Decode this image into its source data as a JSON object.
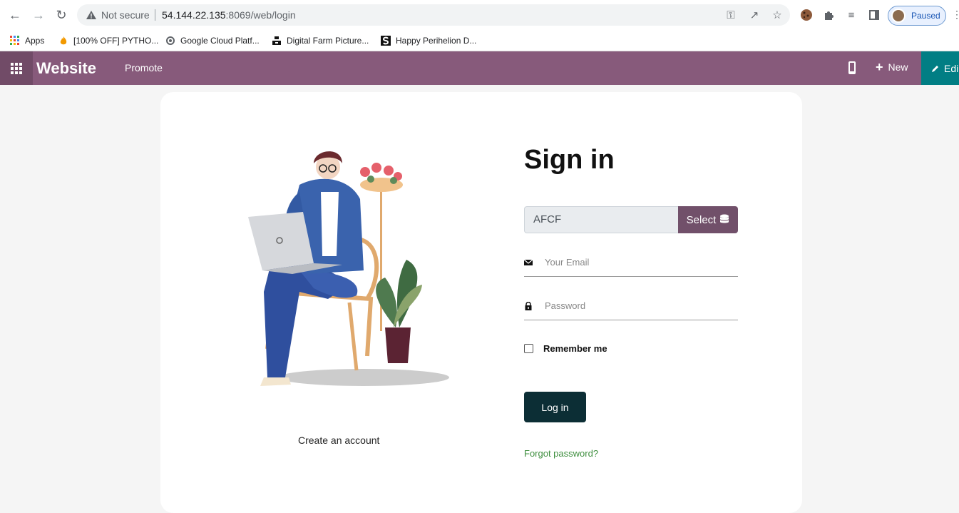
{
  "browser": {
    "security_label": "Not secure",
    "url_host": "54.144.22.135",
    "url_path": ":8069/web/login",
    "profile_label": "Paused",
    "bookmarks": [
      {
        "label": "Apps",
        "icon": "apps-grid-icon"
      },
      {
        "label": "[100% OFF] PYTHO...",
        "icon": "fire-icon"
      },
      {
        "label": "Google Cloud Platf...",
        "icon": "gcp-icon"
      },
      {
        "label": "Digital Farm Picture...",
        "icon": "unsplash-icon"
      },
      {
        "label": "Happy Perihelion D...",
        "icon": "s-logo-icon"
      }
    ]
  },
  "odoo_nav": {
    "brand": "Website",
    "menu_promote": "Promote",
    "new_label": "New",
    "edit_label": "Edi"
  },
  "login": {
    "title": "Sign in",
    "database_value": "AFCF",
    "select_label": "Select",
    "email_placeholder": "Your Email",
    "password_placeholder": "Password",
    "remember_label": "Remember me",
    "login_button": "Log in",
    "forgot_link": "Forgot password?",
    "create_account": "Create an account"
  },
  "colors": {
    "odoo_purple": "#875a7b",
    "apps_purple": "#714b67",
    "edit_teal": "#017e84",
    "login_button": "#0c2e35",
    "forgot_link": "#3f8f3f"
  }
}
